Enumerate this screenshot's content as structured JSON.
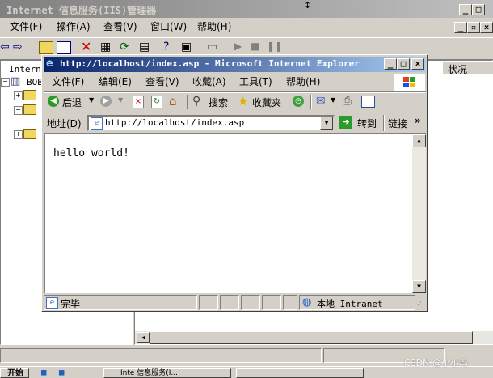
{
  "iis": {
    "title": "Internet 信息服务(IIS)管理器",
    "menu": [
      "文件(F)",
      "操作(A)",
      "查看(V)",
      "窗口(W)",
      "帮助(H)"
    ],
    "tree": [
      "Intern",
      "BOB"
    ],
    "column_status": "状况"
  },
  "ie": {
    "title": "http://localhost/index.asp - Microsoft Internet Explorer",
    "menu": [
      "文件(F)",
      "编辑(E)",
      "查看(V)",
      "收藏(A)",
      "工具(T)",
      "帮助(H)"
    ],
    "toolbar": {
      "back": "后退",
      "search": "搜索",
      "favorites": "收藏夹"
    },
    "address_label": "地址(D)",
    "address_value": "http://localhost/index.asp",
    "go_label": "转到",
    "links_label": "链接",
    "content_text": "hello world!",
    "status_text": "完毕",
    "zone_text": "本地 Intranet"
  },
  "taskbar": {
    "start": "开始",
    "task1": "Inte 信息服务(I..."
  },
  "watermark": "CSDN @小小鸟"
}
